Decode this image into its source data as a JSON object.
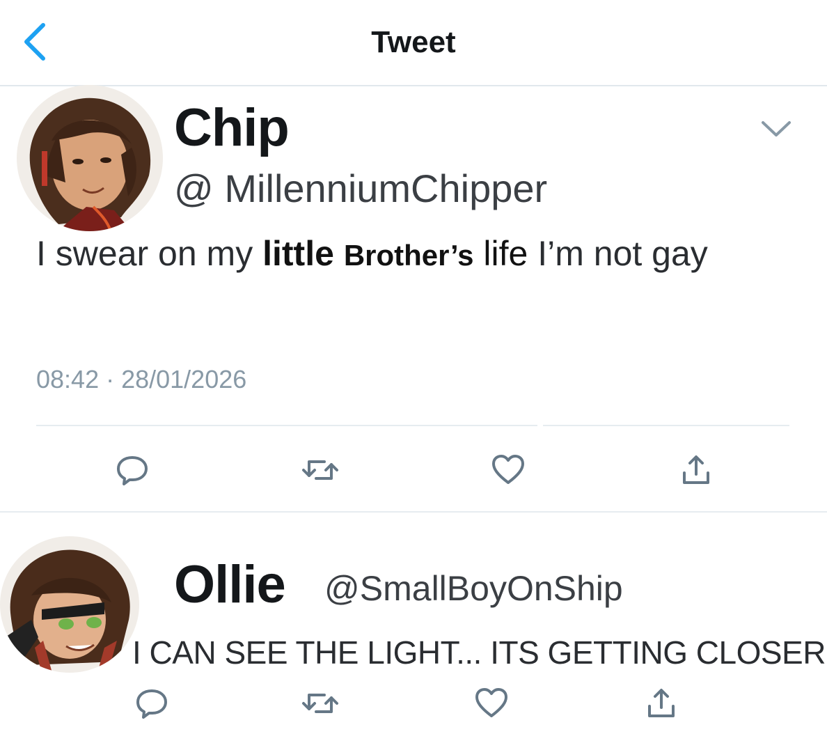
{
  "header": {
    "title": "Tweet",
    "back_icon": "chevron-left-icon",
    "accent": "#1da1f2"
  },
  "main_tweet": {
    "author_name": "Chip",
    "handle": "@ MillenniumChipper",
    "text_part1": "I swear on my ",
    "text_bold1": "little",
    "text_bold2": "Brother’s",
    "text_bold3": "life",
    "text_part2": " I’m not gay",
    "timestamp": "08:42 · 28/01/2026",
    "menu_icon": "chevron-down-icon",
    "actions": [
      "reply-icon",
      "retweet-icon",
      "like-icon",
      "share-icon"
    ]
  },
  "reply_tweet": {
    "author_name": "Ollie",
    "handle": "@SmallBoyOnShip",
    "text": "I CAN SEE THE LIGHT... ITS GETTING CLOSER",
    "actions": [
      "reply-icon",
      "retweet-icon",
      "like-icon",
      "share-icon"
    ]
  },
  "colors": {
    "text": "#14171a",
    "secondary": "#8899a6",
    "icon": "#657786",
    "divider": "#e6ecf0"
  }
}
